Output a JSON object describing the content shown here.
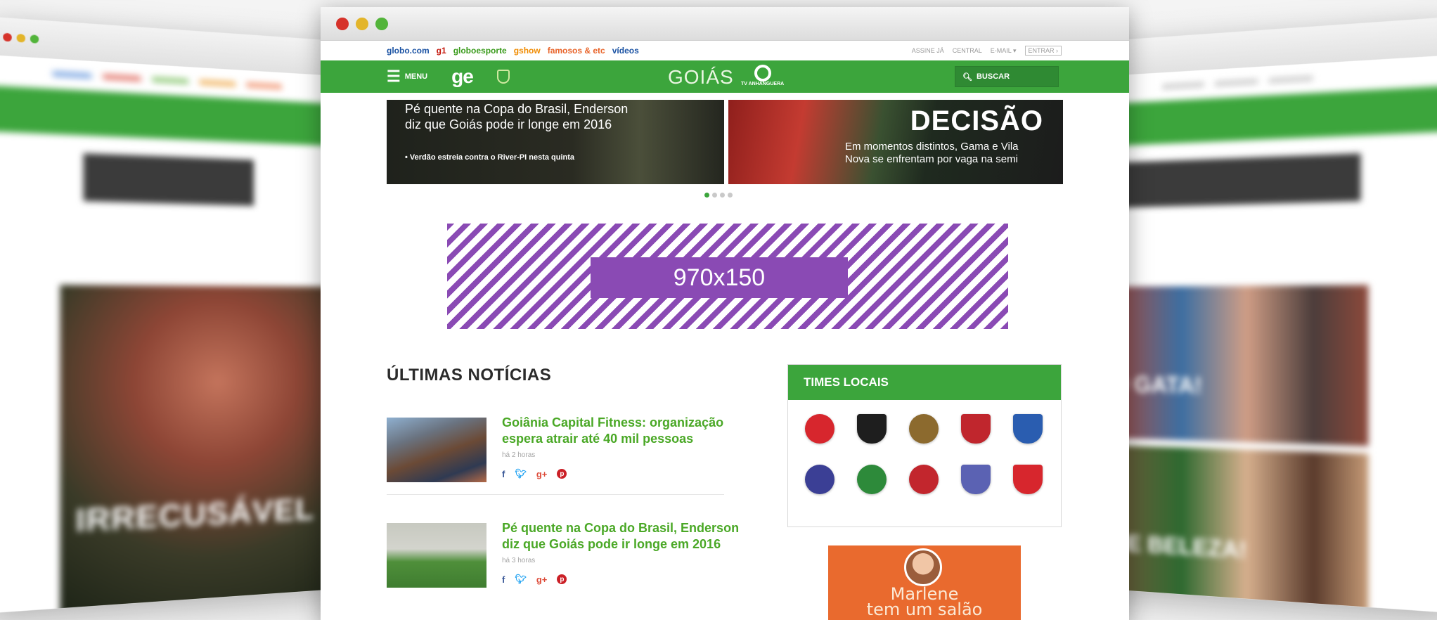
{
  "colors": {
    "brand_green": "#3ca53c",
    "dark_green": "#2f8a33",
    "headline_green": "#4aa826",
    "ad_purple": "#8a4ab4",
    "ad_orange": "#e96a2e"
  },
  "browser": {
    "traffic_lights": [
      "close",
      "minimize",
      "maximize"
    ]
  },
  "globo_bar": {
    "links": [
      {
        "label": "globo.com",
        "color": "#1a52a3"
      },
      {
        "label": "g1",
        "color": "#c4170c"
      },
      {
        "label": "globoesporte",
        "color": "#3a9b1c"
      },
      {
        "label": "gshow",
        "color": "#f08b00"
      },
      {
        "label": "famosos & etc",
        "color": "#e8642a"
      },
      {
        "label": "vídeos",
        "color": "#1a52a3"
      }
    ],
    "right": {
      "assine": "ASSINE JÁ",
      "central": "CENTRAL",
      "email": "E-MAIL ▾",
      "entrar": "ENTRAR ›"
    }
  },
  "nav": {
    "menu_label": "MENU",
    "logo": "ge",
    "region": "GOIÁS",
    "tv_logo_text": "TV ANHANGUERA",
    "search_label": "BUSCAR"
  },
  "carousel": {
    "slides": [
      {
        "headline": "Pé quente na Copa do Brasil, Enderson diz que Goiás pode ir longe em 2016",
        "sub": "• Verdão estreia contra o River-PI nesta quinta"
      },
      {
        "big": "DECISÃO",
        "desc": "Em momentos distintos, Gama e Vila Nova se enfrentam por vaga na semi"
      }
    ],
    "active_index": 0,
    "count": 4
  },
  "ad_banner": {
    "label": "970x150"
  },
  "news": {
    "title": "ÚLTIMAS NOTÍCIAS",
    "items": [
      {
        "headline": "Goiânia Capital Fitness: organização espera atrair até 40 mil pessoas",
        "time": "há 2 horas"
      },
      {
        "headline": "Pé quente na Copa do Brasil, Enderson diz que Goiás pode ir longe em 2016",
        "time": "há 3 horas"
      }
    ],
    "share_icons": [
      "f",
      "t",
      "g+",
      "p"
    ]
  },
  "times": {
    "title": "TIMES LOCAIS",
    "crests": [
      {
        "color": "#d7262d",
        "shape": "round"
      },
      {
        "color": "#1e1e1e",
        "shape": "shield"
      },
      {
        "color": "#8c6a2e",
        "shape": "round"
      },
      {
        "color": "#c0262d",
        "shape": "shield"
      },
      {
        "color": "#2a5db0",
        "shape": "shield"
      },
      {
        "color": "#3b3f95",
        "shape": "round"
      },
      {
        "color": "#2d8a3a",
        "shape": "round"
      },
      {
        "color": "#c2262d",
        "shape": "round"
      },
      {
        "color": "#5b62b3",
        "shape": "shield"
      },
      {
        "color": "#d7262d",
        "shape": "shield"
      }
    ]
  },
  "ad_right": {
    "line1": "Marlene",
    "line2": "tem um salão"
  },
  "side_left": {
    "big": "IRRECUSÁVEL"
  },
  "side_right": {
    "big1": "O GATA!",
    "big2": "UE BELEZA!"
  }
}
